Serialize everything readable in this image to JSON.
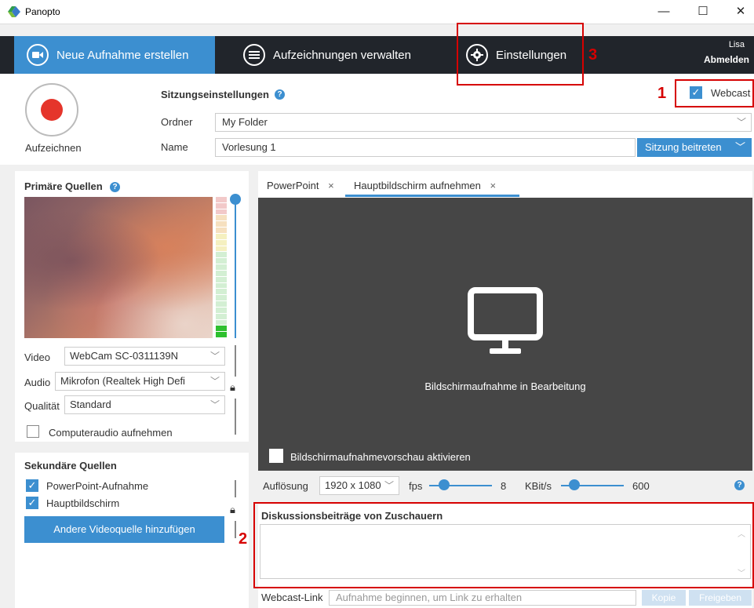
{
  "window": {
    "title": "Panopto",
    "minimize": "—",
    "maximize": "☐",
    "close": "✕"
  },
  "nav": {
    "new_recording": "Neue Aufnahme erstellen",
    "manage_recordings": "Aufzeichnungen verwalten",
    "settings": "Einstellungen",
    "user": "Lisa",
    "logout": "Abmelden"
  },
  "session": {
    "record_label": "Aufzeichnen",
    "settings_label": "Sitzungseinstellungen",
    "folder_label": "Ordner",
    "folder_value": "My Folder",
    "name_label": "Name",
    "name_value": "Vorlesung 1",
    "join_button": "Sitzung beitreten",
    "webcast_label": "Webcast",
    "webcast_checked": true
  },
  "primary": {
    "title": "Primäre Quellen",
    "video_label": "Video",
    "video_value": "WebCam SC-0311139N",
    "audio_label": "Audio",
    "audio_value": "Mikrofon (Realtek High Defi",
    "quality_label": "Qualität",
    "quality_value": "Standard",
    "computer_audio": "Computeraudio aufnehmen"
  },
  "secondary": {
    "title": "Sekundäre Quellen",
    "items": [
      {
        "label": "PowerPoint-Aufnahme",
        "checked": true
      },
      {
        "label": "Hauptbildschirm",
        "checked": true
      }
    ],
    "add_button": "Andere Videoquelle hinzufügen"
  },
  "tabs": [
    {
      "label": "PowerPoint",
      "close": "×"
    },
    {
      "label": "Hauptbildschirm aufnehmen",
      "close": "×"
    }
  ],
  "preview": {
    "status": "Bildschirmaufnahme in Bearbeitung",
    "enable_preview": "Bildschirmaufnahmevorschau aktivieren"
  },
  "controls": {
    "resolution_label": "Auflösung",
    "resolution_value": "1920 x 1080",
    "fps_label": "fps",
    "fps_value": "8",
    "kbit_label": "KBit/s",
    "kbit_value": "600"
  },
  "discussion": {
    "title": "Diskussionsbeiträge von Zuschauern"
  },
  "webcast_link": {
    "label": "Webcast-Link",
    "placeholder": "Aufnahme beginnen, um Link zu erhalten",
    "copy": "Kopie",
    "share": "Freigeben"
  },
  "annotations": {
    "n1": "1",
    "n2": "2",
    "n3": "3"
  },
  "colors": {
    "accent": "#3c8fd0",
    "navbar": "#21252b",
    "record": "#e5352b",
    "highlight": "#d60000"
  }
}
